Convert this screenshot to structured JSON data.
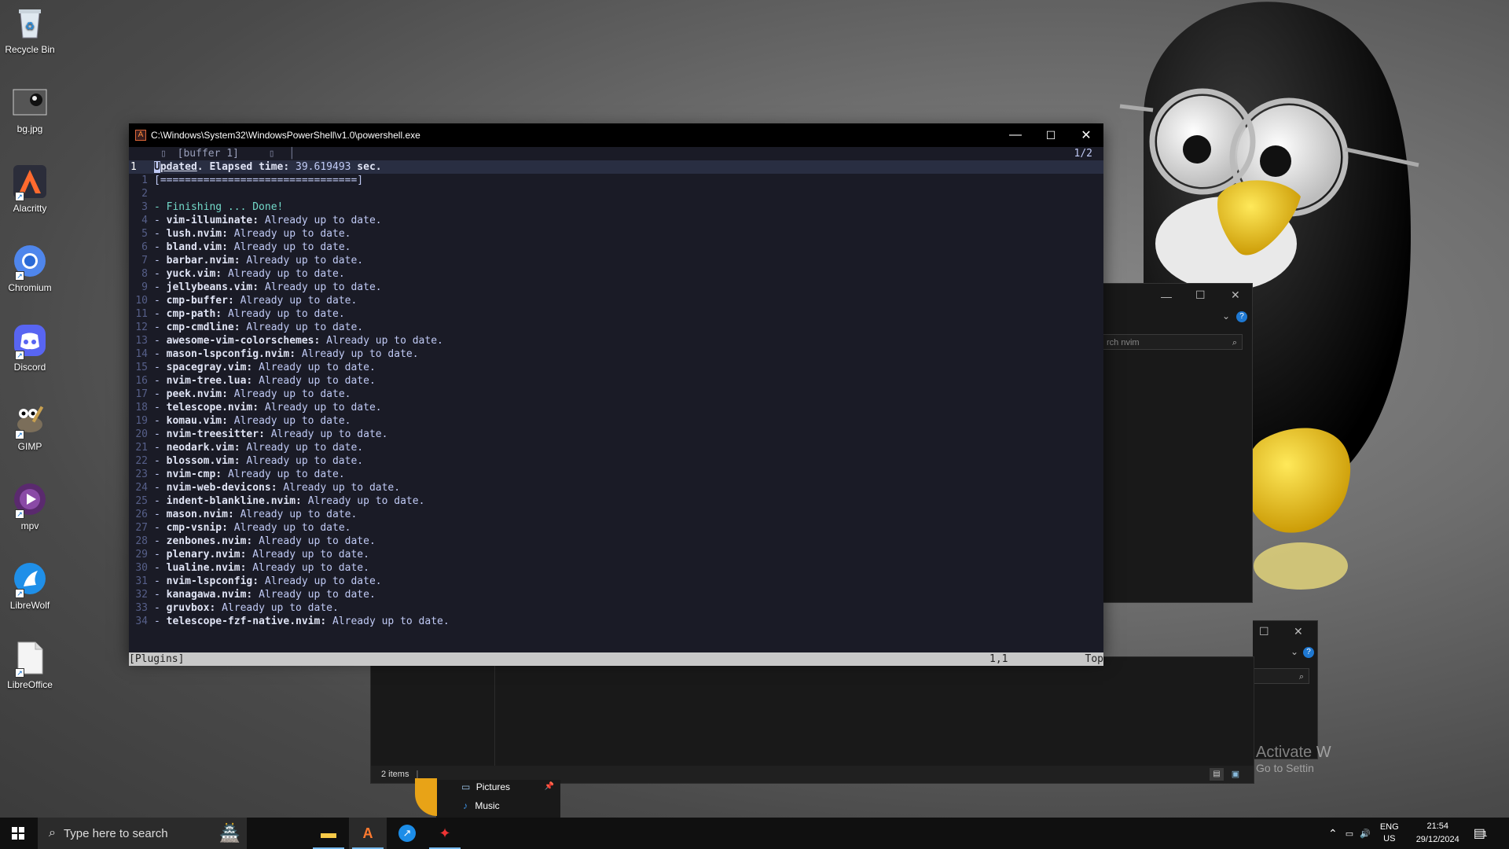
{
  "desktop": {
    "icons": [
      {
        "label": "Recycle Bin",
        "icon": "recycle-bin-icon"
      },
      {
        "label": "bg.jpg",
        "icon": "image-file-icon"
      },
      {
        "label": "Alacritty",
        "icon": "alacritty-icon"
      },
      {
        "label": "Chromium",
        "icon": "chromium-icon"
      },
      {
        "label": "Discord",
        "icon": "discord-icon"
      },
      {
        "label": "GIMP",
        "icon": "gimp-icon"
      },
      {
        "label": "mpv",
        "icon": "mpv-icon"
      },
      {
        "label": "LibreWolf",
        "icon": "librewolf-icon"
      },
      {
        "label": "LibreOffice",
        "icon": "libreoffice-icon"
      }
    ],
    "watermark": {
      "line1": "Activate W",
      "line2": "Go to Settin"
    }
  },
  "terminal": {
    "title": "C:\\Windows\\System32\\WindowsPowerShell\\v1.0\\powershell.exe",
    "tab_label": "[buffer 1]",
    "page_count": "1/2",
    "header": {
      "number": "1",
      "cursor_char": "U",
      "word": "pdated",
      "rest_label": ". Elapsed time:",
      "elapsed": " 39.619493 ",
      "unit": "sec."
    },
    "progress": "[================================]",
    "finishing": "- Finishing ... Done!",
    "status_text": "Already up to date.",
    "plugins": [
      "vim-illuminate",
      "lush.nvim",
      "bland.vim",
      "barbar.nvim",
      "yuck.vim",
      "jellybeans.vim",
      "cmp-buffer",
      "cmp-path",
      "cmp-cmdline",
      "awesome-vim-colorschemes",
      "mason-lspconfig.nvim",
      "spacegray.vim",
      "nvim-tree.lua",
      "peek.nvim",
      "telescope.nvim",
      "komau.vim",
      "nvim-treesitter",
      "neodark.vim",
      "blossom.vim",
      "nvim-cmp",
      "nvim-web-devicons",
      "indent-blankline.nvim",
      "mason.nvim",
      "cmp-vsnip",
      "zenbones.nvim",
      "plenary.nvim",
      "lualine.nvim",
      "nvim-lspconfig",
      "kanagawa.nvim",
      "gruvbox",
      "telescope-fzf-native.nvim"
    ],
    "statusline": {
      "name": "[Plugins]",
      "position": "1,1",
      "scroll": "Top"
    },
    "colors": {
      "bg": "#1a1b26",
      "fg": "#c0caf5",
      "accent": "#73daca"
    }
  },
  "explorer": {
    "search_placeholder_1": "rch nvim",
    "items_count": "2 items",
    "nav": [
      {
        "label": "Pictures"
      },
      {
        "label": "Music"
      }
    ]
  },
  "taskbar": {
    "search_placeholder": "Type here to search",
    "language": "ENG",
    "region": "US",
    "time": "21:54",
    "date": "29/12/2024",
    "notifications": "1"
  }
}
